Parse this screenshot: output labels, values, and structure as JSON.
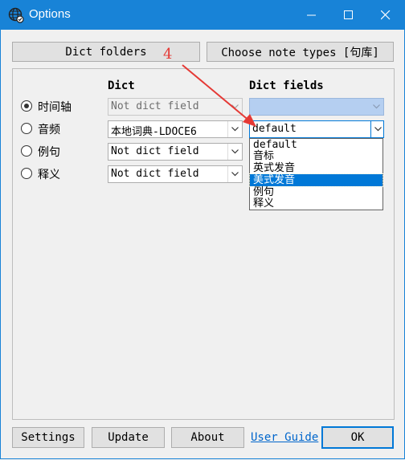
{
  "window": {
    "title": "Options",
    "app_icon": "globe-icon"
  },
  "title_controls": {
    "minimize": "minimize-icon",
    "maximize": "maximize-icon",
    "close": "close-icon"
  },
  "top_buttons": {
    "dict_folders": "Dict folders",
    "choose_note_types": "Choose note types [句库]"
  },
  "headers": {
    "dict": "Dict",
    "dict_fields": "Dict fields"
  },
  "rows": [
    {
      "label": "时间轴",
      "checked": true,
      "dict": "Not dict field",
      "field": ""
    },
    {
      "label": "音频",
      "checked": false,
      "dict": "本地词典-LDOCE6",
      "field": "default"
    },
    {
      "label": "例句",
      "checked": false,
      "dict": "Not dict field"
    },
    {
      "label": "释义",
      "checked": false,
      "dict": "Not dict field"
    }
  ],
  "dropdown_options": [
    "default",
    "音标",
    "英式发音",
    "美式发音",
    "例句",
    "释义"
  ],
  "dropdown_selected": "美式发音",
  "annotation": {
    "number": "4",
    "color": "#e53935"
  },
  "bottom_buttons": {
    "settings": "Settings",
    "update": "Update",
    "about": "About",
    "user_guide": "User Guide",
    "ok": "OK"
  },
  "colors": {
    "titlebar": "#1883d7",
    "accent": "#0078d7",
    "selection": "#0078d7"
  }
}
